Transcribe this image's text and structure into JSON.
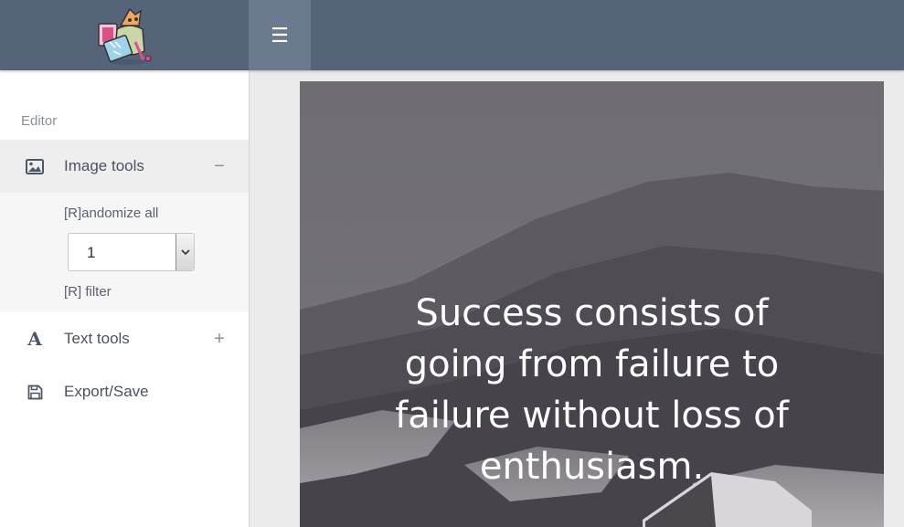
{
  "header": {
    "logo_icon": "cartoon-mascot-logo",
    "menu_icon": "hamburger-icon",
    "menu_glyph": "☰"
  },
  "sidebar": {
    "heading": "Editor",
    "items": [
      {
        "label": "Image tools",
        "icon": "image-icon",
        "toggle": "−",
        "expanded": true
      },
      {
        "label": "Text tools",
        "icon": "text-a-icon",
        "toggle": "+",
        "expanded": false
      },
      {
        "label": "Export/Save",
        "icon": "floppy-disk-icon",
        "toggle": "",
        "expanded": false
      }
    ],
    "image_tools": {
      "randomize_label": "[R]andomize all",
      "select_value": "1",
      "filter_label": "[R] filter"
    }
  },
  "canvas": {
    "quote_lines": [
      "Success consists of",
      "going from failure to",
      "failure without loss of",
      "enthusiasm."
    ],
    "text_color": "#ffffff"
  },
  "colors": {
    "header": "#56647a",
    "toggle_bg": "#6c7a8f",
    "sidebar_bg": "#ffffff",
    "submenu_bg": "#f6f6f6"
  }
}
